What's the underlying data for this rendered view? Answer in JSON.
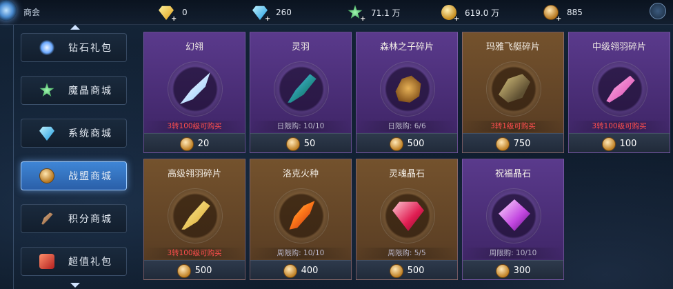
{
  "header": {
    "title": "商会",
    "resources": [
      {
        "icon": "yellow-diamond-icon",
        "value": "0"
      },
      {
        "icon": "blue-diamond-icon",
        "value": "260"
      },
      {
        "icon": "magic-crystal-icon",
        "value": "71.1 万"
      },
      {
        "icon": "gold-coin-icon",
        "value": "619.0 万"
      },
      {
        "icon": "guild-coin-icon",
        "value": "885"
      }
    ],
    "plus_glyph": "+"
  },
  "sidebar": {
    "tabs": [
      {
        "label": "钻石礼包",
        "icon": "diamond-gift-icon",
        "active": false
      },
      {
        "label": "魔晶商城",
        "icon": "magic-crystal-icon",
        "active": false
      },
      {
        "label": "系统商城",
        "icon": "blue-diamond-icon",
        "active": false
      },
      {
        "label": "战盟商城",
        "icon": "guild-coin-icon",
        "active": true
      },
      {
        "label": "积分商城",
        "icon": "feather-icon",
        "active": false
      },
      {
        "label": "超值礼包",
        "icon": "gift-box-icon",
        "active": false
      }
    ]
  },
  "shop": {
    "items": [
      {
        "name": "幻翎",
        "limit": "3转100级可购买",
        "limit_red": true,
        "price": "20",
        "theme": "purple",
        "icon": "white-wing-icon"
      },
      {
        "name": "灵羽",
        "limit": "日限购: 10/10",
        "limit_red": false,
        "price": "50",
        "theme": "purple",
        "icon": "blue-feather-icon"
      },
      {
        "name": "森林之子碎片",
        "limit": "日限购: 6/6",
        "limit_red": false,
        "price": "500",
        "theme": "purple",
        "icon": "dragon-mount-icon"
      },
      {
        "name": "玛雅飞艇碎片",
        "limit": "3转1级可购买",
        "limit_red": true,
        "price": "750",
        "theme": "gold",
        "icon": "airship-icon"
      },
      {
        "name": "中级翎羽碎片",
        "limit": "3转100级可购买",
        "limit_red": true,
        "price": "100",
        "theme": "purple",
        "icon": "pink-feather-icon"
      },
      {
        "name": "高级翎羽碎片",
        "limit": "3转100级可购买",
        "limit_red": true,
        "price": "500",
        "theme": "gold",
        "icon": "gold-feather-icon"
      },
      {
        "name": "洛克火种",
        "limit": "周限购: 10/10",
        "limit_red": false,
        "price": "400",
        "theme": "gold",
        "icon": "fire-feather-icon"
      },
      {
        "name": "灵魂晶石",
        "limit": "周限购: 5/5",
        "limit_red": false,
        "price": "500",
        "theme": "gold",
        "icon": "ruby-gem-icon"
      },
      {
        "name": "祝福晶石",
        "limit": "周限购: 10/10",
        "limit_red": false,
        "price": "300",
        "theme": "purple",
        "icon": "amethyst-gem-icon"
      }
    ],
    "currency_icon": "guild-coin-icon"
  }
}
